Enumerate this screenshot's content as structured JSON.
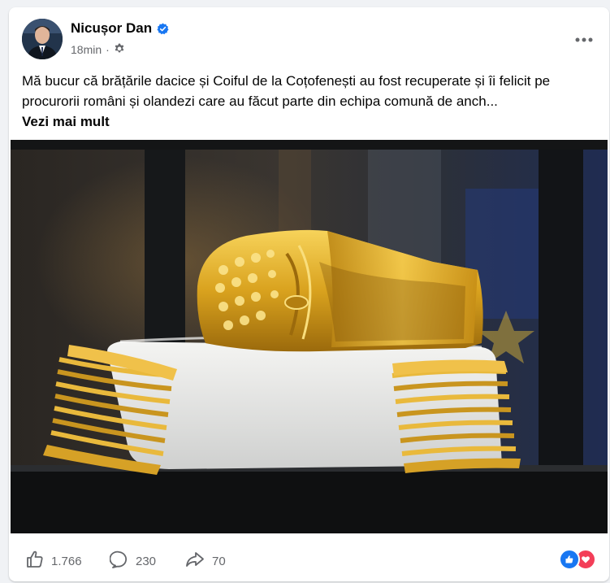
{
  "post": {
    "author": "Nicușor Dan",
    "time": "18min",
    "text": "Mă bucur că brățările dacice și Coiful de la Coțofenești au fost recuperate și îi felicit pe procurorii români și olandezi care au făcut parte din echipa comună de anch...",
    "see_more": "Vezi mai mult"
  },
  "stats": {
    "likes": "1.766",
    "comments": "230",
    "shares": "70"
  },
  "icons": {
    "verified": "verified-badge-icon",
    "audience": "gear-icon",
    "more": "more-horizontal-icon",
    "like": "thumbs-up-icon",
    "comment": "comment-bubble-icon",
    "share": "share-arrow-icon",
    "reaction_like": "like-reaction-icon",
    "reaction_love": "love-reaction-icon"
  },
  "colors": {
    "accent": "#1877f2",
    "love": "#f33e58",
    "secondary_text": "#65676b"
  }
}
